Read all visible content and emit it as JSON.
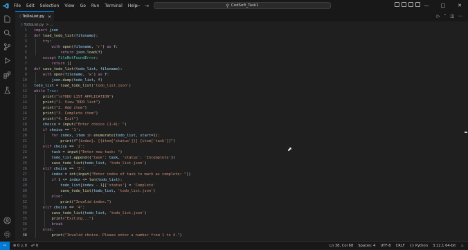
{
  "menu": {
    "items": [
      "File",
      "Edit",
      "Selection",
      "View",
      "Go",
      "Run",
      "Terminal",
      "Help"
    ]
  },
  "search": {
    "text": "CodSoft_Task1"
  },
  "tab": {
    "label": "ToDoList.py",
    "close": "×"
  },
  "breadcrumb": {
    "file": "ToDoList.py",
    "rest": "> ..."
  },
  "code": [
    "import json",
    "def load_todo_list(filename):",
    "    try:",
    "        with open(filename, 'r') as f:",
    "            return json.load(f)",
    "    except FileNotFoundError:",
    "        return []",
    "def save_todo_list(todo_list, filename):",
    "    with open(filename, 'w') as f:",
    "        json.dump(todo_list, f)",
    "todo_list = load_todo_list('todo_list.json')",
    "while True:",
    "    print(\"\\nTODO LIST APPLICATION\")",
    "    print(\"1. View TODO list\")",
    "    print(\"2. Add item\")",
    "    print(\"3. Complete item\")",
    "    print(\"4. Exit\")",
    "    choice = input(\"Enter choice (1-4): \")",
    "    if choice == '1':",
    "        for index, item in enumerate(todo_list, start=1):",
    "            print(f\"{index}. [{item['status']}] {item['task']}\")",
    "    elif choice == '2':",
    "        task = input(\"Enter new task: \")",
    "        todo_list.append({'task': task, 'status': 'Incomplete'})",
    "        save_todo_list(todo_list, 'todo_list.json')",
    "    elif choice == '3':",
    "        index = int(input(\"Enter index of task to mark as complete: \"))",
    "        if 1 <= index <= len(todo_list):",
    "            todo_list[index - 1]['status'] = 'Complete'",
    "            save_todo_list(todo_list, 'todo_list.json')",
    "        else:",
    "            print(\"Invalid index.\")",
    "    elif choice == '4':",
    "        save_todo_list(todo_list, 'todo_list.json')",
    "        print(\"Exiting...\")",
    "        break",
    "    else:",
    "        print(\"Invalid choice. Please enter a number from 1 to 4.\")"
  ],
  "status": {
    "errors": "0",
    "warnings": "0",
    "ports": "0",
    "position": "Ln 38, Col 68",
    "spaces": "Spaces: 4",
    "encoding": "UTF-8",
    "eol": "CRLF",
    "language": "Python",
    "interpreter": "3.12.1 64-bit"
  },
  "colors": {
    "accent": "#0078d4",
    "editor_bg": "#1f1f1f",
    "chrome_bg": "#181818"
  }
}
